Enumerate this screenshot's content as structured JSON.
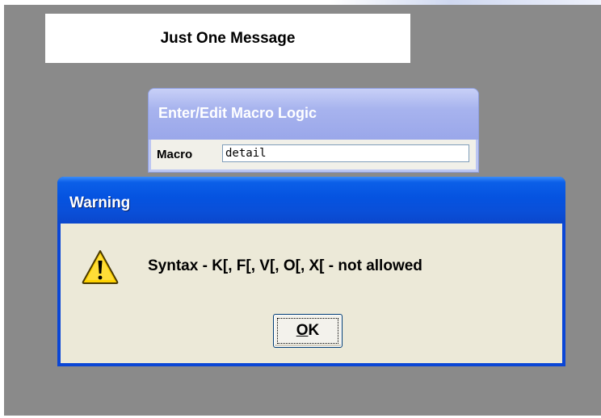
{
  "message_panel": {
    "text": "Just One Message"
  },
  "macro_window": {
    "title": "Enter/Edit Macro Logic",
    "field_label": "Macro",
    "field_value": "detail"
  },
  "warning_dialog": {
    "title": "Warning",
    "icon": "warning-icon",
    "message": "Syntax - K[, F[, V[, O[, X[ - not allowed",
    "ok_button": {
      "label_mnemonic": "O",
      "label_rest": "K"
    }
  },
  "colors": {
    "desktop": "#8a8a8a",
    "warning_titlebar": "#0553e0",
    "macro_titlebar": "#a7b3ee",
    "dialog_body": "#ece9d8",
    "warning_icon_fill": "#ffd200"
  }
}
